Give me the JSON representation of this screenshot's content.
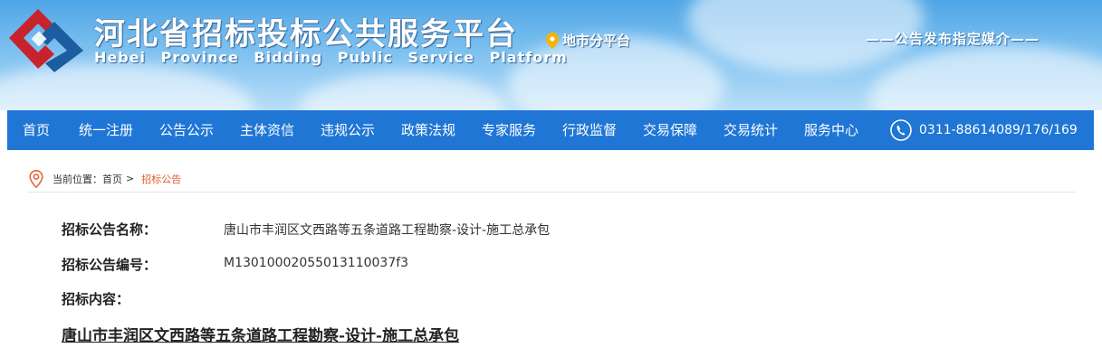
{
  "header": {
    "title": "河北省招标投标公共服务平台",
    "subtitle": "Hebei Province Bidding Public Service Platform",
    "city_link": "地市分平台",
    "media_note": "——公告发布指定媒介——",
    "colors": {
      "banner_sky": "#6db6ee",
      "logo_red": "#c8232c",
      "logo_blue": "#1b5d9e"
    }
  },
  "nav": {
    "items": [
      {
        "label": "首页"
      },
      {
        "label": "统一注册"
      },
      {
        "label": "公告公示"
      },
      {
        "label": "主体资信"
      },
      {
        "label": "违规公示"
      },
      {
        "label": "政策法规"
      },
      {
        "label": "专家服务"
      },
      {
        "label": "行政监督"
      },
      {
        "label": "交易保障"
      },
      {
        "label": "交易统计"
      },
      {
        "label": "服务中心"
      }
    ],
    "phone": "0311-88614089/176/169",
    "color": "#1f76d5"
  },
  "breadcrumb": {
    "prefix": "当前位置：",
    "home": "首页",
    "separator": ">",
    "current": "招标公告",
    "current_color": "#e05c2b"
  },
  "notice": {
    "name_label": "招标公告名称：",
    "name_value": "唐山市丰润区文西路等五条道路工程勘察-设计-施工总承包",
    "code_label": "招标公告编号：",
    "code_value": "M1301000205501311003​7f3",
    "content_label": "招标内容：",
    "content_heading": "唐山市丰润区文西路等五条道路工程勘察-设计-施工总承包"
  }
}
